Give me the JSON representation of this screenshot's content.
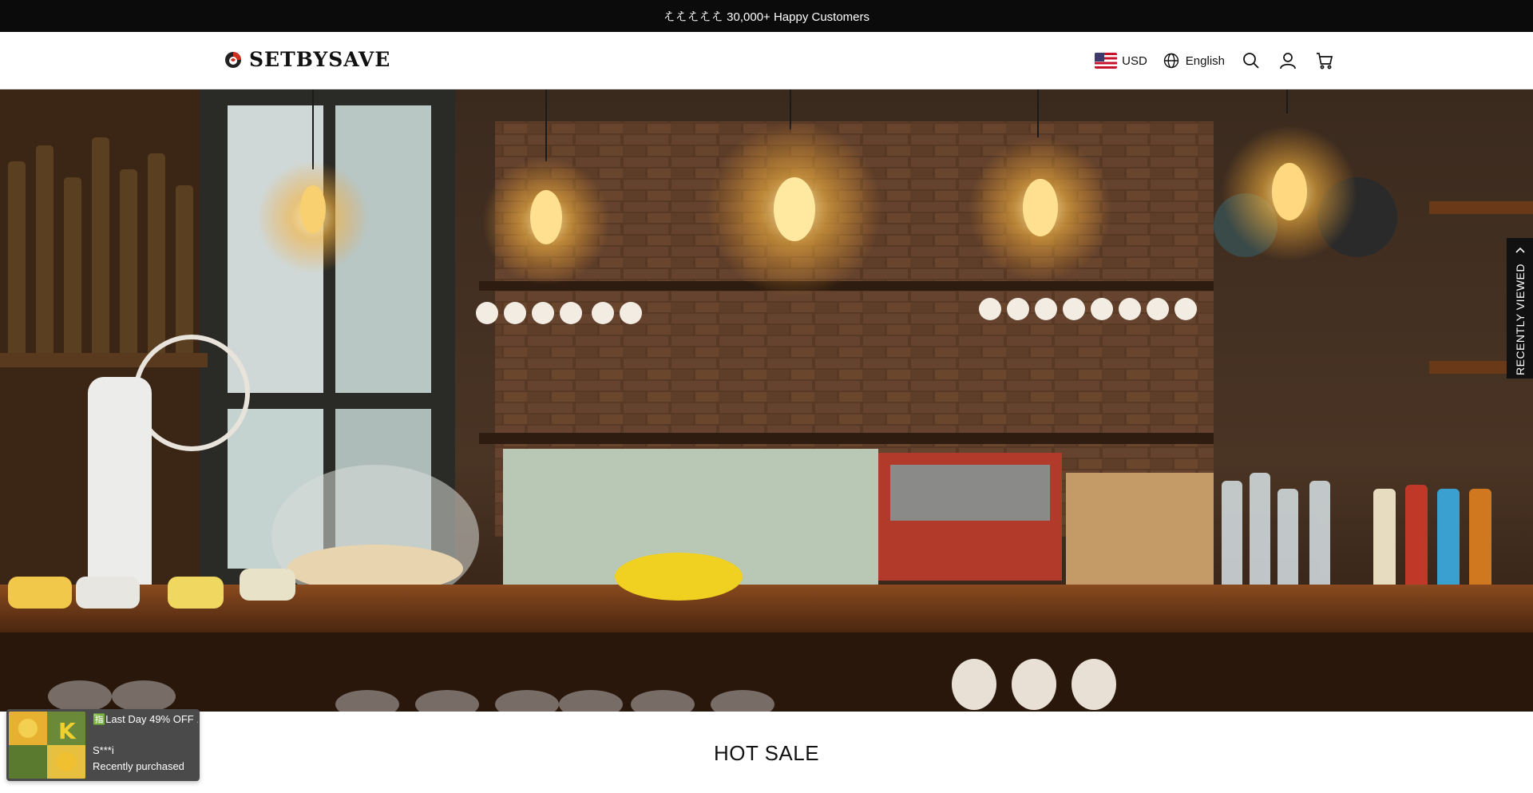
{
  "announcement": {
    "text": "𛂦𛂦𛂦𛂦𛂦 30,000+ Happy Customers"
  },
  "header": {
    "logo_text": "SETBYSAVE",
    "currency": "USD",
    "language": "English",
    "icons": [
      "globe-icon",
      "search-icon",
      "account-icon",
      "cart-icon"
    ]
  },
  "hero": {
    "description_icon": "cafe-bar-image"
  },
  "recently_viewed": {
    "label": "RECENTLY VIEWED"
  },
  "section": {
    "title": "HOT SALE"
  },
  "toast": {
    "title": "🈯Last Day 49% OFF ...",
    "user": "S***i",
    "status": "Recently purchased"
  },
  "colors": {
    "announcement_bg": "#0b0b0b",
    "toast_bg": "#4a4a4a",
    "logo_accent": "#d2301f"
  }
}
